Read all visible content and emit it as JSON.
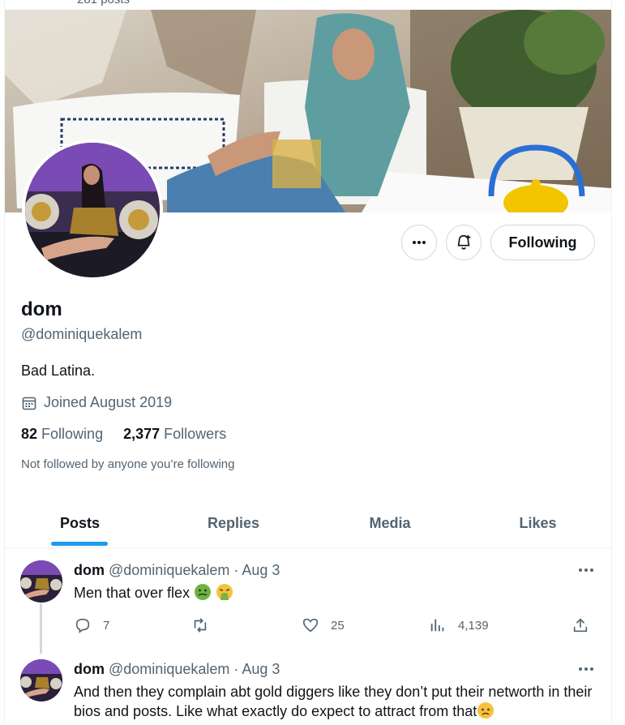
{
  "header": {
    "posts_count_text": "281 posts"
  },
  "profile": {
    "display_name": "dom",
    "handle": "@dominiquekalem",
    "bio": "Bad Latina.",
    "joined": "Joined August 2019",
    "following_count": "82",
    "following_label": "Following",
    "followers_count": "2,377",
    "followers_label": "Followers",
    "not_followed_text": "Not followed by anyone you’re following",
    "follow_button_label": "Following"
  },
  "tabs": [
    {
      "label": "Posts",
      "active": true
    },
    {
      "label": "Replies",
      "active": false
    },
    {
      "label": "Media",
      "active": false
    },
    {
      "label": "Likes",
      "active": false
    }
  ],
  "tweets": [
    {
      "name": "dom",
      "meta": "@dominiquekalem · Aug 3",
      "text": "Men that over flex",
      "emojis": [
        "nauseated-face-emoji",
        "vomiting-face-emoji"
      ],
      "replies": "7",
      "retweets": "",
      "likes": "25",
      "views": "4,139"
    },
    {
      "name": "dom",
      "meta": "@dominiquekalem · Aug 3",
      "text": "And then they complain abt gold diggers like they don’t put their networth in their bios and posts. Like what exactly do expect to attract from that",
      "emojis": [
        "worried-face-emoji"
      ]
    }
  ],
  "colors": {
    "accent": "#1d9bf0",
    "secondary_text": "#536471",
    "border": "#cfd9de"
  }
}
